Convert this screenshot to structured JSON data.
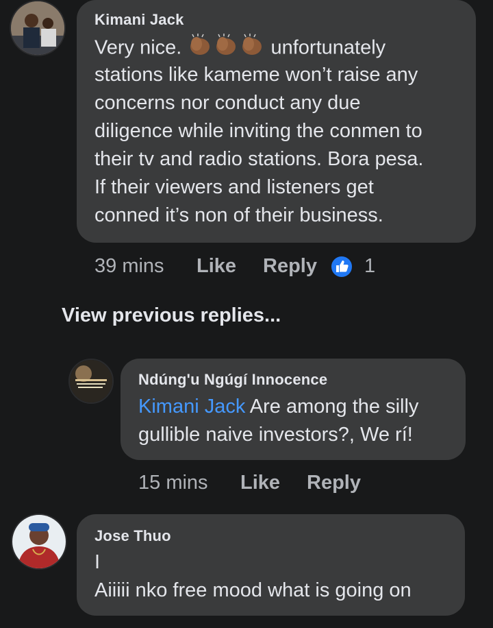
{
  "comment1": {
    "author": "Kimani Jack",
    "text_start": "Very nice. ",
    "emojis": [
      "clapping-hands-icon",
      "clapping-hands-icon",
      "clapping-hands-icon"
    ],
    "line1_rest": " unfortunately",
    "line2": "stations like kameme won’t raise any",
    "line3": "concerns nor conduct any due",
    "line4": "diligence while inviting the conmen to",
    "line5": "their tv and radio stations. Bora pesa.",
    "line6": "If their viewers and listeners get",
    "line7": "conned it’s non of their business.",
    "time": "39 mins",
    "like_label": "Like",
    "reply_label": "Reply",
    "reaction_icon": "like-reaction-icon",
    "reaction_count": "1"
  },
  "view_previous_label": "View previous replies...",
  "reply1": {
    "author": "Ndúng'u Ngúgí Innocence",
    "mention": "Kimani Jack",
    "text_rest": " Are among the silly",
    "line2": "gullible naive investors?, We rí!",
    "time": "15 mins",
    "like_label": "Like",
    "reply_label": "Reply",
    "accent": "#4599ff"
  },
  "comment2": {
    "author": "Jose Thuo",
    "line1": "I",
    "line2": "Aiiiii nko free mood what is going on"
  }
}
